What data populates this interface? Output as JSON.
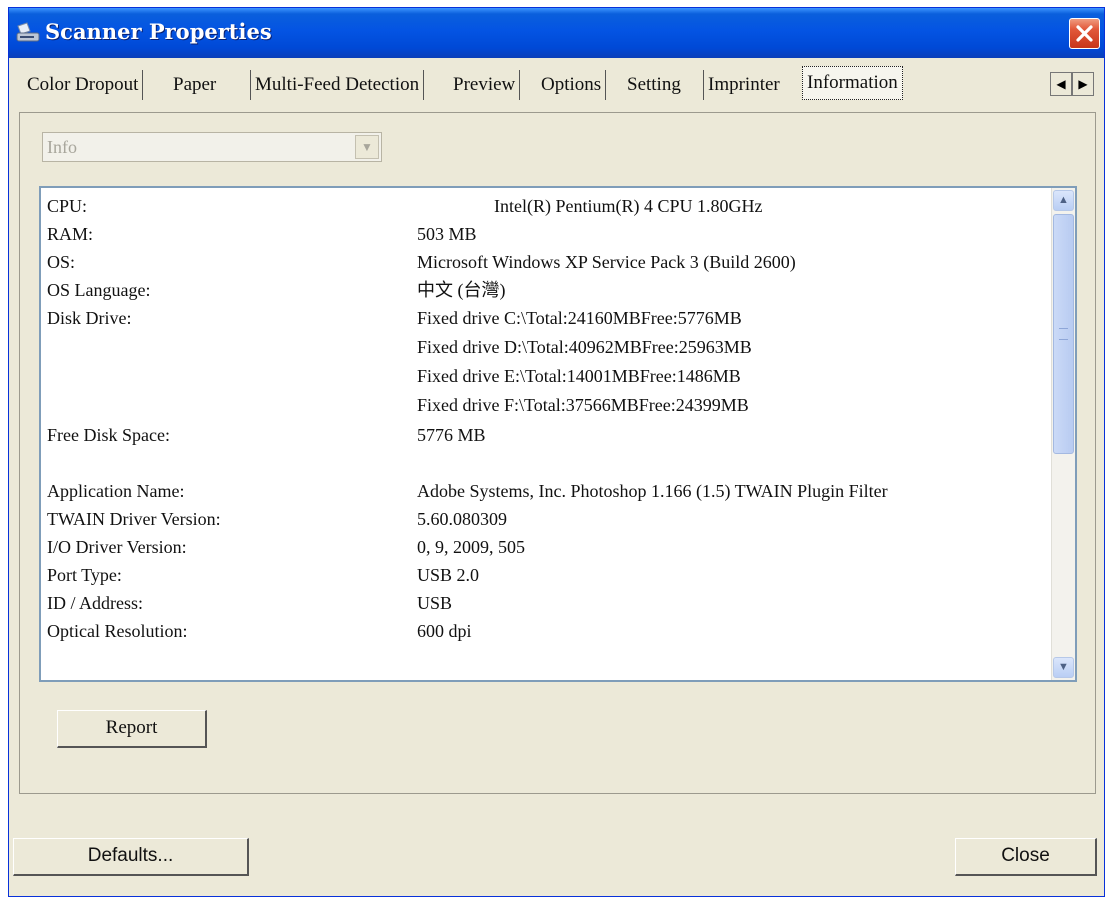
{
  "window": {
    "title": "Scanner Properties"
  },
  "tabs": [
    {
      "label": "Color Dropout"
    },
    {
      "label": "Paper"
    },
    {
      "label": "Multi-Feed Detection"
    },
    {
      "label": "Preview"
    },
    {
      "label": "Options"
    },
    {
      "label": "Setting"
    },
    {
      "label": "Imprinter"
    },
    {
      "label": "Information"
    }
  ],
  "active_tab": "Information",
  "info_select": {
    "value": "Info"
  },
  "info_rows": [
    {
      "label": "CPU:",
      "value": "Intel(R) Pentium(R) 4 CPU 1.80GHz"
    },
    {
      "label": "RAM:",
      "value": "503 MB"
    },
    {
      "label": "OS:",
      "value": "Microsoft Windows XP Service Pack 3 (Build 2600)"
    },
    {
      "label": "OS Language:",
      "value": "中文 (台灣)"
    },
    {
      "label": "Disk Drive:",
      "value": "Fixed drive C:\\Total:24160MBFree:5776MB"
    },
    {
      "label": "",
      "value": "Fixed drive D:\\Total:40962MBFree:25963MB"
    },
    {
      "label": "",
      "value": "Fixed drive E:\\Total:14001MBFree:1486MB"
    },
    {
      "label": "",
      "value": "Fixed drive F:\\Total:37566MBFree:24399MB"
    },
    {
      "label": "Free Disk Space:",
      "value": "5776 MB"
    },
    {
      "label": "Application Name:",
      "value": "Adobe Systems, Inc. Photoshop 1.166 (1.5) TWAIN Plugin Filter"
    },
    {
      "label": "TWAIN Driver Version:",
      "value": "5.60.080309"
    },
    {
      "label": "I/O Driver Version:",
      "value": "0, 9, 2009, 505"
    },
    {
      "label": "Port Type:",
      "value": "USB 2.0"
    },
    {
      "label": "ID / Address:",
      "value": "USB"
    },
    {
      "label": "Optical Resolution:",
      "value": "600 dpi"
    }
  ],
  "buttons": {
    "report": "Report",
    "defaults": "Defaults...",
    "close": "Close"
  },
  "icons": {
    "app": "scanner-icon",
    "close": "close-icon",
    "tab_left": "arrow-left-icon",
    "tab_right": "arrow-right-icon",
    "dropdown": "chevron-down-icon",
    "scroll_up": "chevron-up-icon",
    "scroll_down": "chevron-down-icon"
  },
  "colors": {
    "titlebar": "#0454e3",
    "window_bg": "#ece9d8",
    "close_button": "#d9512c",
    "list_border": "#7f9db9",
    "scrollbar_thumb": "#c0d2f4"
  }
}
